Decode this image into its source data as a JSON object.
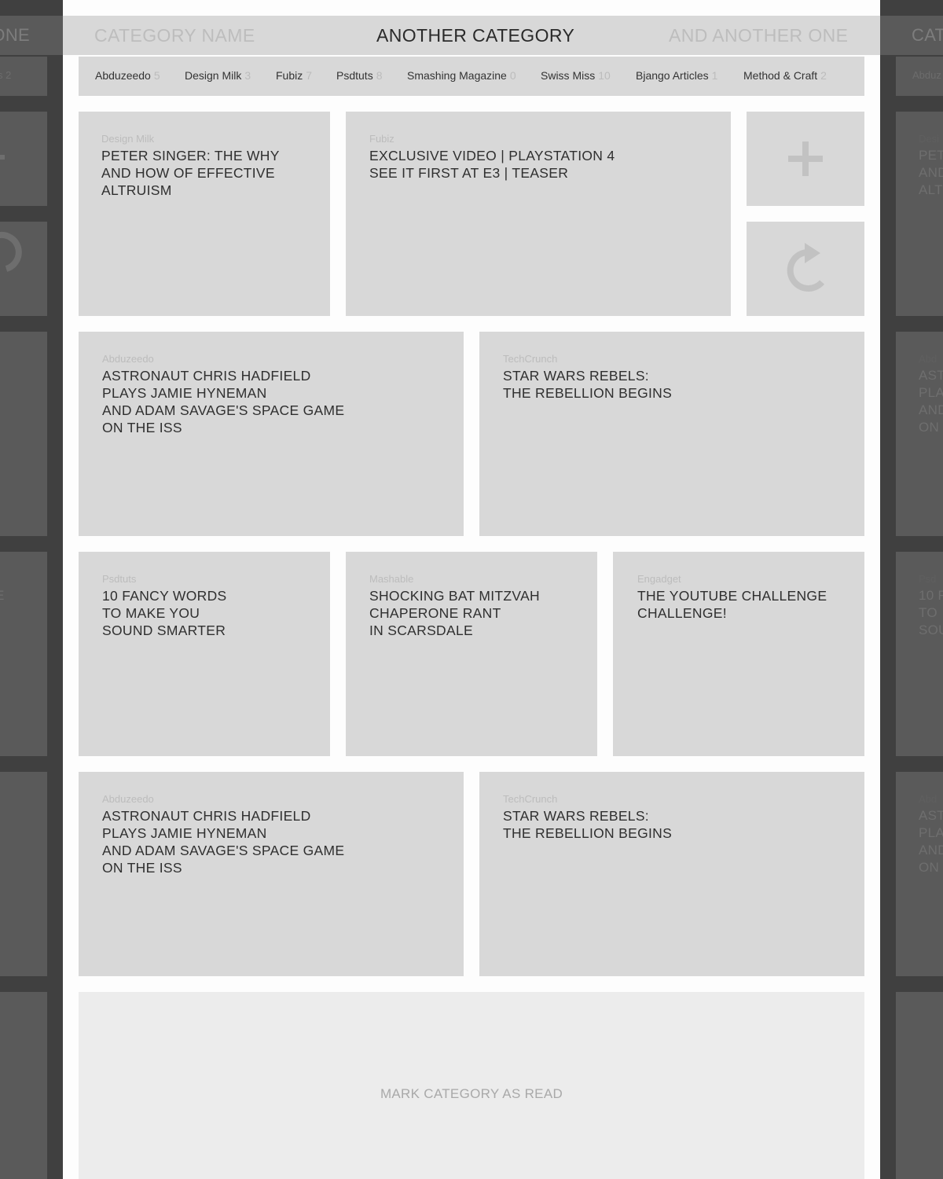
{
  "categories": {
    "prev": "CATEGORY NAME",
    "current": "ANOTHER CATEGORY",
    "next": "AND ANOTHER ONE",
    "peek_left_fragment": "ONE",
    "peek_right_fragment": "CAT"
  },
  "feeds": [
    {
      "name": "Abduzeedo",
      "count": "5"
    },
    {
      "name": "Design Milk",
      "count": "3"
    },
    {
      "name": "Fubiz",
      "count": "7"
    },
    {
      "name": "Psdtuts",
      "count": "8"
    },
    {
      "name": "Smashing Magazine",
      "count": "0"
    },
    {
      "name": "Swiss Miss",
      "count": "10"
    },
    {
      "name": "Bjango Articles",
      "count": "1"
    },
    {
      "name": "Method & Craft",
      "count": "2"
    }
  ],
  "articles": [
    {
      "source": "Design Milk",
      "title": "PETER SINGER: THE WHY\nAND HOW OF EFFECTIVE\nALTRUISM"
    },
    {
      "source": "Fubiz",
      "title": "EXCLUSIVE VIDEO | PLAYSTATION 4\nSEE IT FIRST AT E3 | TEASER"
    },
    {
      "source": "Abduzeedo",
      "title": "ASTRONAUT CHRIS HADFIELD\nPLAYS JAMIE HYNEMAN\nAND ADAM SAVAGE'S SPACE GAME\nON THE ISS"
    },
    {
      "source": "TechCrunch",
      "title": "STAR WARS REBELS:\nTHE REBELLION BEGINS"
    },
    {
      "source": "Psdtuts",
      "title": "10 FANCY WORDS\nTO MAKE YOU\nSOUND SMARTER"
    },
    {
      "source": "Mashable",
      "title": "SHOCKING BAT MITZVAH\nCHAPERONE RANT\nIN SCARSDALE"
    },
    {
      "source": "Engadget",
      "title": "THE YOUTUBE CHALLENGE\nCHALLENGE!"
    },
    {
      "source": "Abduzeedo",
      "title": "ASTRONAUT CHRIS HADFIELD\nPLAYS JAMIE HYNEMAN\nAND ADAM SAVAGE'S SPACE GAME\nON THE ISS"
    },
    {
      "source": "TechCrunch",
      "title": "STAR WARS REBELS:\nTHE REBELLION BEGINS"
    }
  ],
  "actions": {
    "add_icon": "plus-icon",
    "refresh_icon": "refresh-icon",
    "mark_read_label": "MARK CATEGORY AS READ"
  },
  "peek": {
    "left": {
      "feed_fragment": "s 2",
      "tiles": [
        {
          "title": "E"
        }
      ]
    },
    "right": {
      "feed_fragment": "Abduz",
      "tiles": [
        {
          "source": "Desi",
          "title": "PET\nAND\nALT"
        },
        {
          "source": "Abd",
          "title": "AST\nPLA\nAND\nON"
        },
        {
          "source": "Psd",
          "title": "10 F\nTO\nSOU"
        },
        {
          "source": "Abd",
          "title": "AST\nPLA\nAND\nON"
        }
      ]
    }
  },
  "colors": {
    "tile": "#d8d8d8",
    "panel": "#fdfdfd",
    "backdrop": "#3a3a3a",
    "muted_text": "#bcbcbc"
  }
}
